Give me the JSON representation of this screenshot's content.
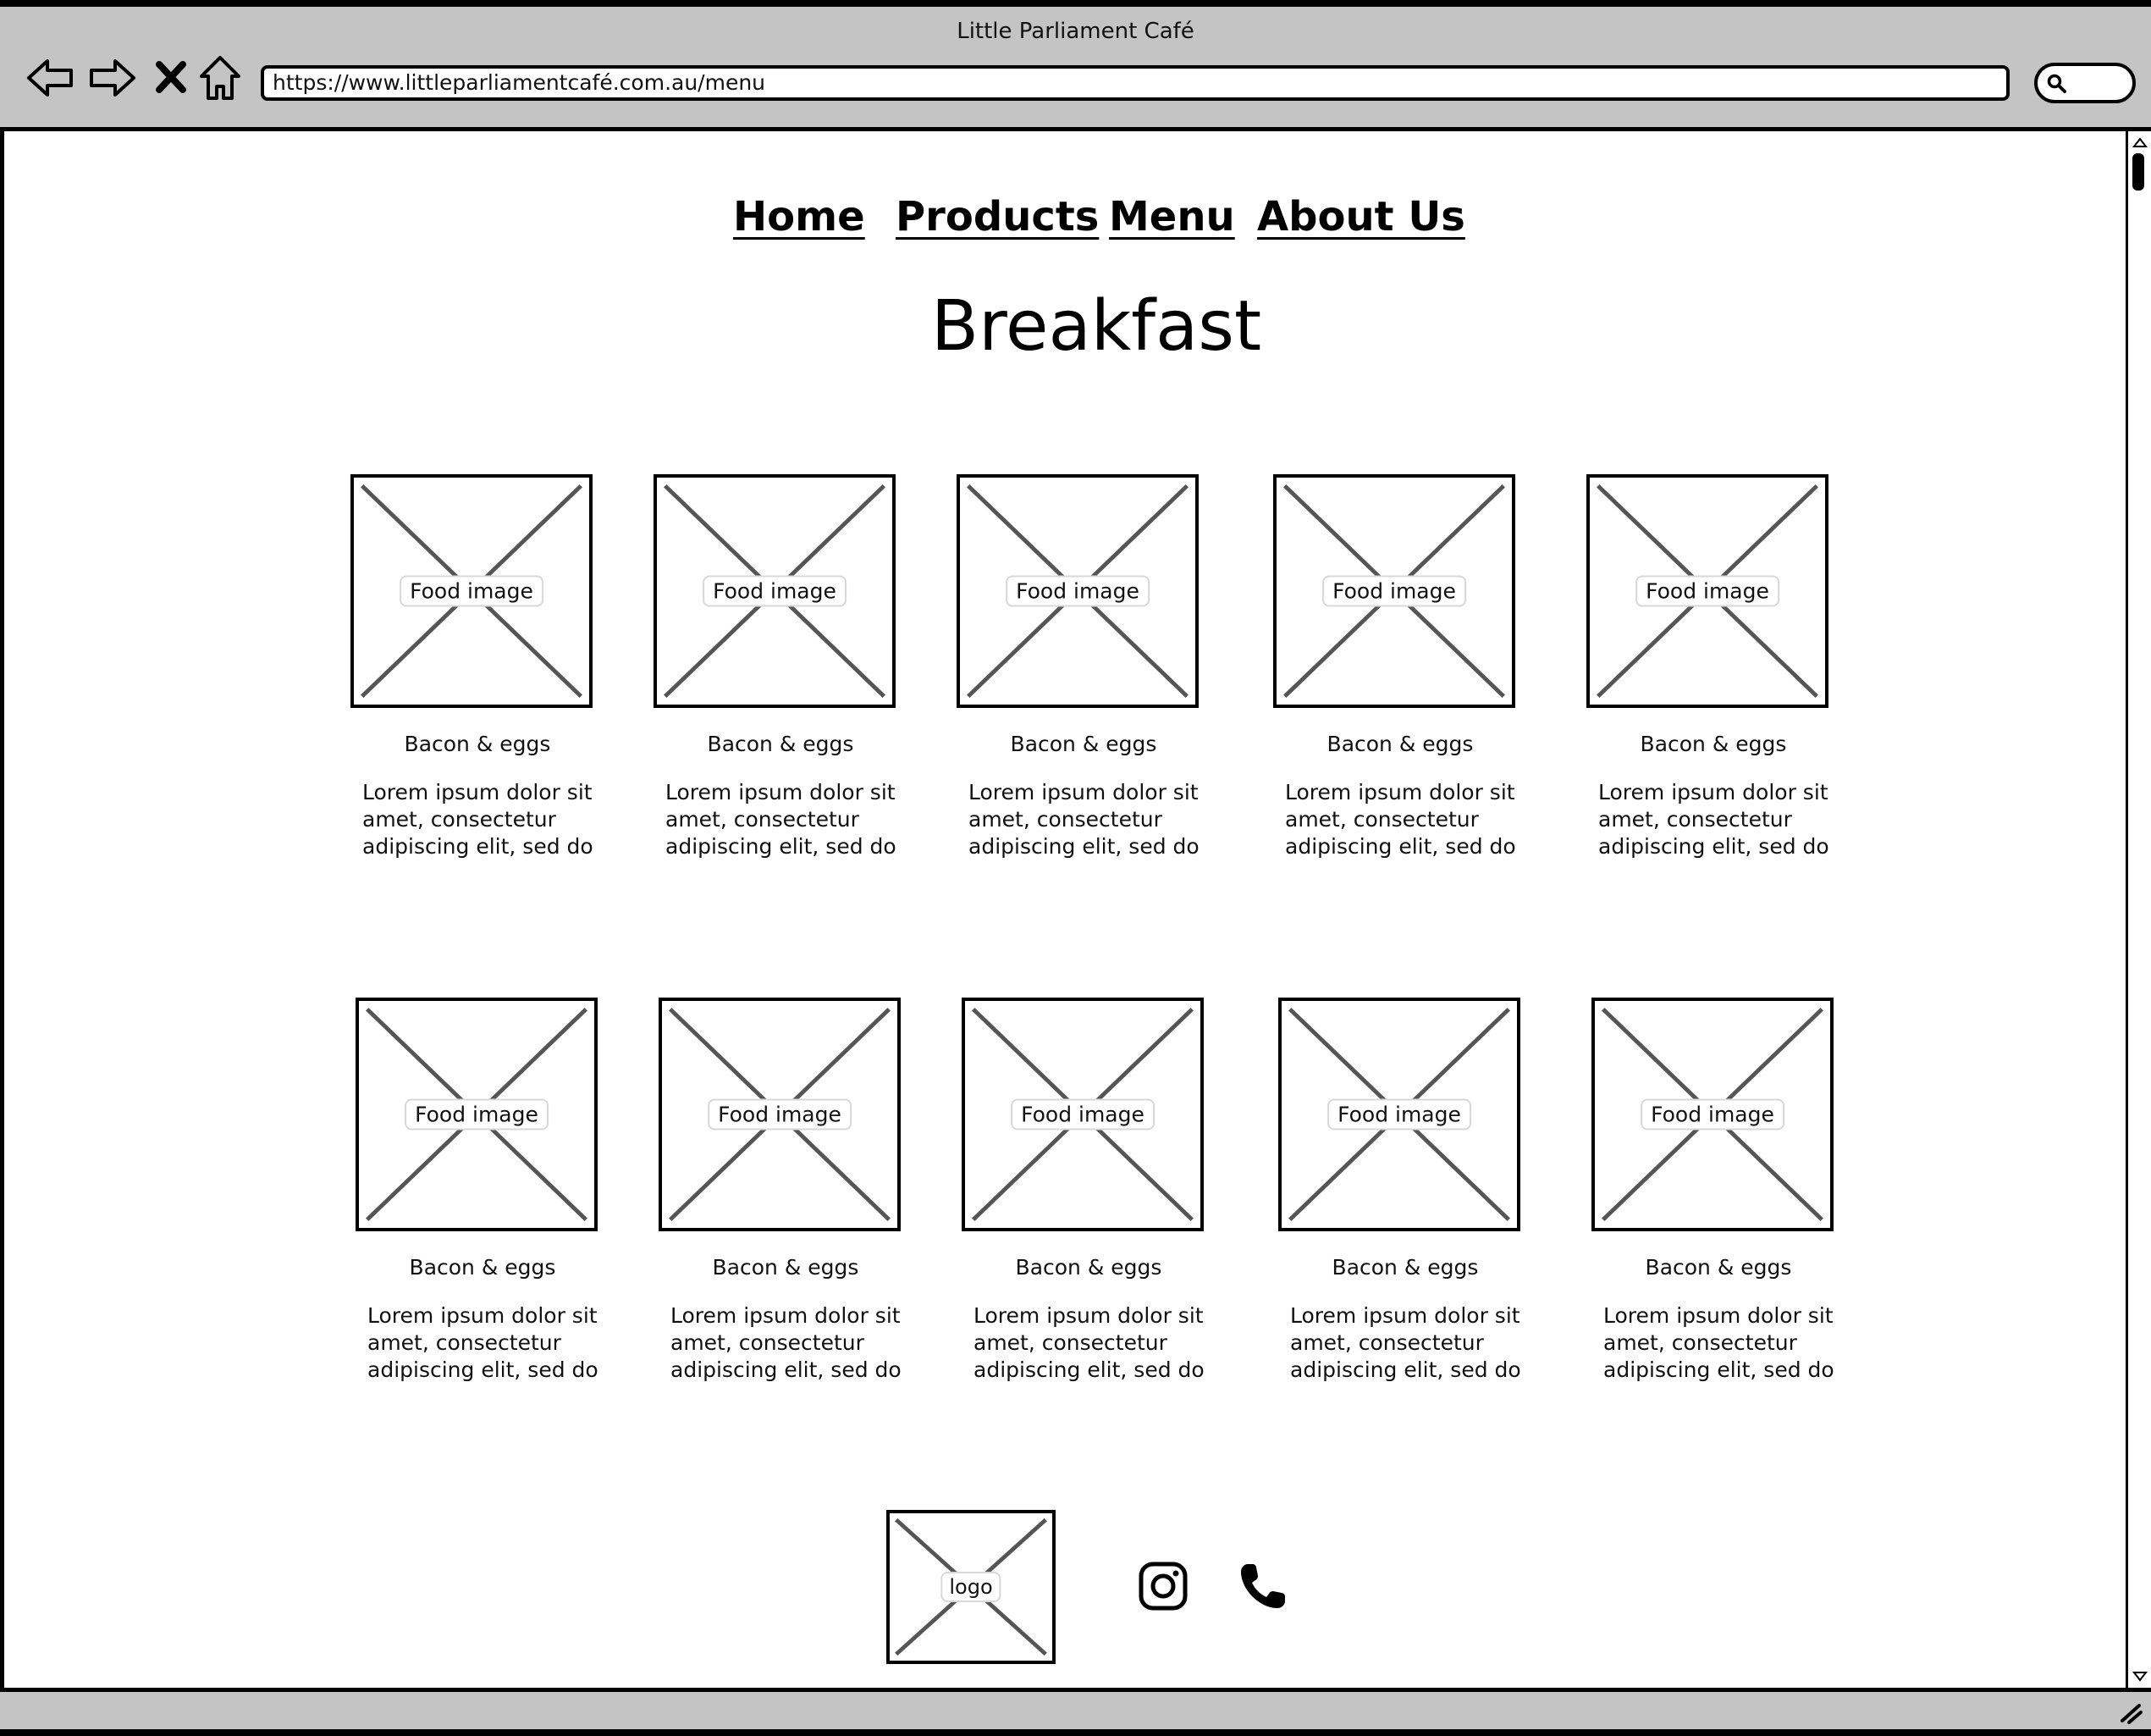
{
  "window": {
    "title": "Little Parliament Café",
    "url": "https://www.littleparliamentcafé.com.au/menu"
  },
  "toolbar": {
    "back_icon": "back-arrow-icon",
    "forward_icon": "forward-arrow-icon",
    "stop_icon": "close-x-icon",
    "home_icon": "home-icon",
    "search_icon": "search-icon"
  },
  "nav": {
    "items": [
      {
        "label": "Home"
      },
      {
        "label": "Products"
      },
      {
        "label": "Menu"
      },
      {
        "label": "About Us"
      }
    ]
  },
  "page": {
    "title": "Breakfast"
  },
  "menu_items": [
    {
      "image_label": "Food image",
      "name": "Bacon & eggs",
      "desc": "Lorem ipsum dolor sit amet, consectetur adipiscing elit, sed do"
    },
    {
      "image_label": "Food image",
      "name": "Bacon & eggs",
      "desc": "Lorem ipsum dolor sit amet, consectetur adipiscing elit, sed do"
    },
    {
      "image_label": "Food image",
      "name": "Bacon & eggs",
      "desc": "Lorem ipsum dolor sit amet, consectetur adipiscing elit, sed do"
    },
    {
      "image_label": "Food image",
      "name": "Bacon & eggs",
      "desc": "Lorem ipsum dolor sit amet, consectetur adipiscing elit, sed do"
    },
    {
      "image_label": "Food image",
      "name": "Bacon & eggs",
      "desc": "Lorem ipsum dolor sit amet, consectetur adipiscing elit, sed do"
    },
    {
      "image_label": "Food image",
      "name": "Bacon & eggs",
      "desc": "Lorem ipsum dolor sit amet, consectetur adipiscing elit, sed do"
    },
    {
      "image_label": "Food image",
      "name": "Bacon & eggs",
      "desc": "Lorem ipsum dolor sit amet, consectetur adipiscing elit, sed do"
    },
    {
      "image_label": "Food image",
      "name": "Bacon & eggs",
      "desc": "Lorem ipsum dolor sit amet, consectetur adipiscing elit, sed do"
    },
    {
      "image_label": "Food image",
      "name": "Bacon & eggs",
      "desc": "Lorem ipsum dolor sit amet, consectetur adipiscing elit, sed do"
    },
    {
      "image_label": "Food image",
      "name": "Bacon & eggs",
      "desc": "Lorem ipsum dolor sit amet, consectetur adipiscing elit, sed do"
    }
  ],
  "footer": {
    "logo_label": "logo",
    "instagram_icon": "instagram-icon",
    "phone_icon": "phone-icon"
  },
  "colors": {
    "chrome": "#c4c4c4",
    "placeholder_cross": "#555555"
  }
}
